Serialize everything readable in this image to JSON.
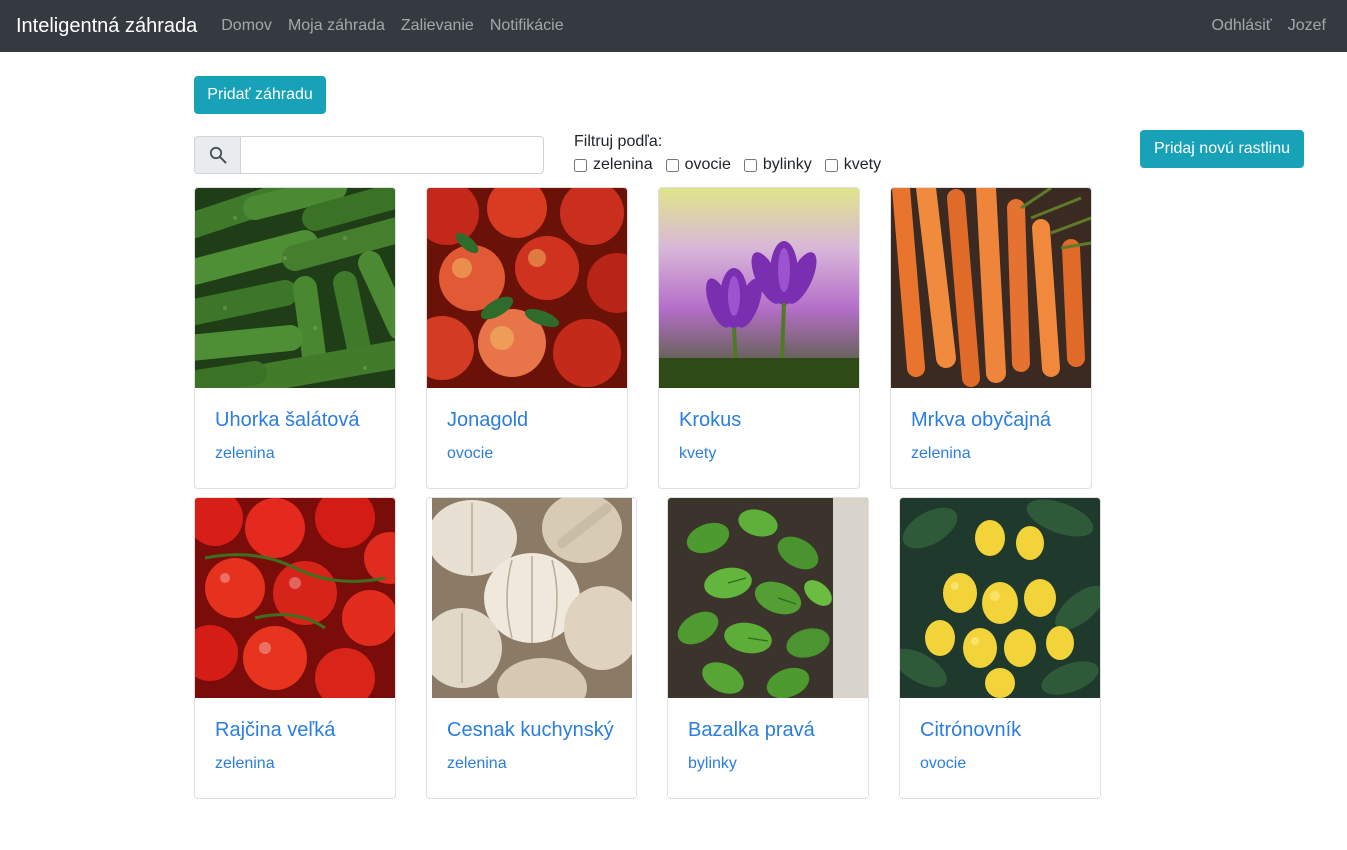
{
  "navbar": {
    "brand": "Inteligentná záhrada",
    "links": [
      "Domov",
      "Moja záhrada",
      "Zalievanie",
      "Notifikácie"
    ],
    "right": [
      "Odhlásiť",
      "Jozef"
    ]
  },
  "actions": {
    "add_garden": "Pridať záhradu",
    "add_plant": "Pridaj novú rastlinu"
  },
  "search": {
    "value": "",
    "placeholder": ""
  },
  "filter": {
    "title": "Filtruj podľa:",
    "options": [
      "zelenina",
      "ovocie",
      "bylinky",
      "kvety"
    ]
  },
  "plants": [
    {
      "name": "Uhorka šalátová",
      "category": "zelenina",
      "image": "cucumbers"
    },
    {
      "name": "Jonagold",
      "category": "ovocie",
      "image": "apples"
    },
    {
      "name": "Krokus",
      "category": "kvety",
      "image": "crocus"
    },
    {
      "name": "Mrkva obyčajná",
      "category": "zelenina",
      "image": "carrots"
    },
    {
      "name": "Rajčina veľká",
      "category": "zelenina",
      "image": "tomatoes"
    },
    {
      "name": "Cesnak kuchynský",
      "category": "zelenina",
      "image": "garlic"
    },
    {
      "name": "Bazalka pravá",
      "category": "bylinky",
      "image": "basil"
    },
    {
      "name": "Citrónovník",
      "category": "ovocie",
      "image": "lemons"
    }
  ]
}
